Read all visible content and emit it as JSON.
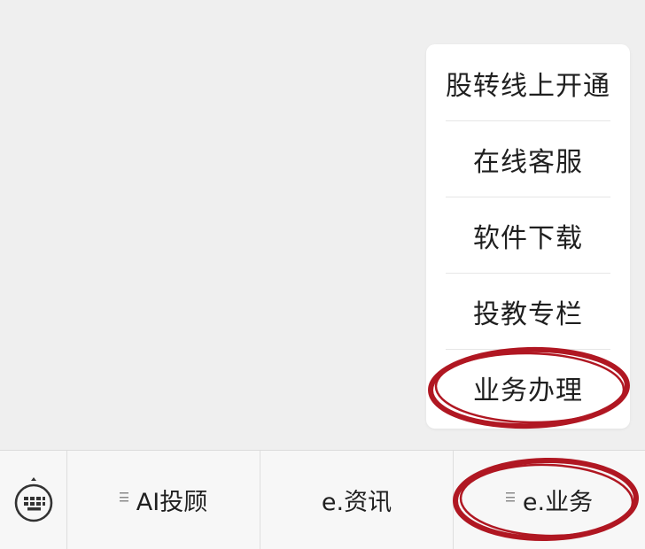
{
  "submenu": {
    "items": [
      {
        "label": "股转线上开通"
      },
      {
        "label": "在线客服"
      },
      {
        "label": "软件下载"
      },
      {
        "label": "投教专栏"
      },
      {
        "label": "业务办理"
      }
    ]
  },
  "menubar": {
    "keyboard_icon": "keyboard-icon",
    "tabs": [
      {
        "label": "AI投顾",
        "has_submenu": true
      },
      {
        "label": "e.资讯",
        "has_submenu": false
      },
      {
        "label": "e.业务",
        "has_submenu": true
      }
    ]
  },
  "annotation": {
    "color": "#b01722",
    "highlighted": [
      "业务办理",
      "e.业务"
    ]
  },
  "colors": {
    "background": "#efefef",
    "menu_bg": "#ffffff",
    "text": "#1f1f1f"
  }
}
